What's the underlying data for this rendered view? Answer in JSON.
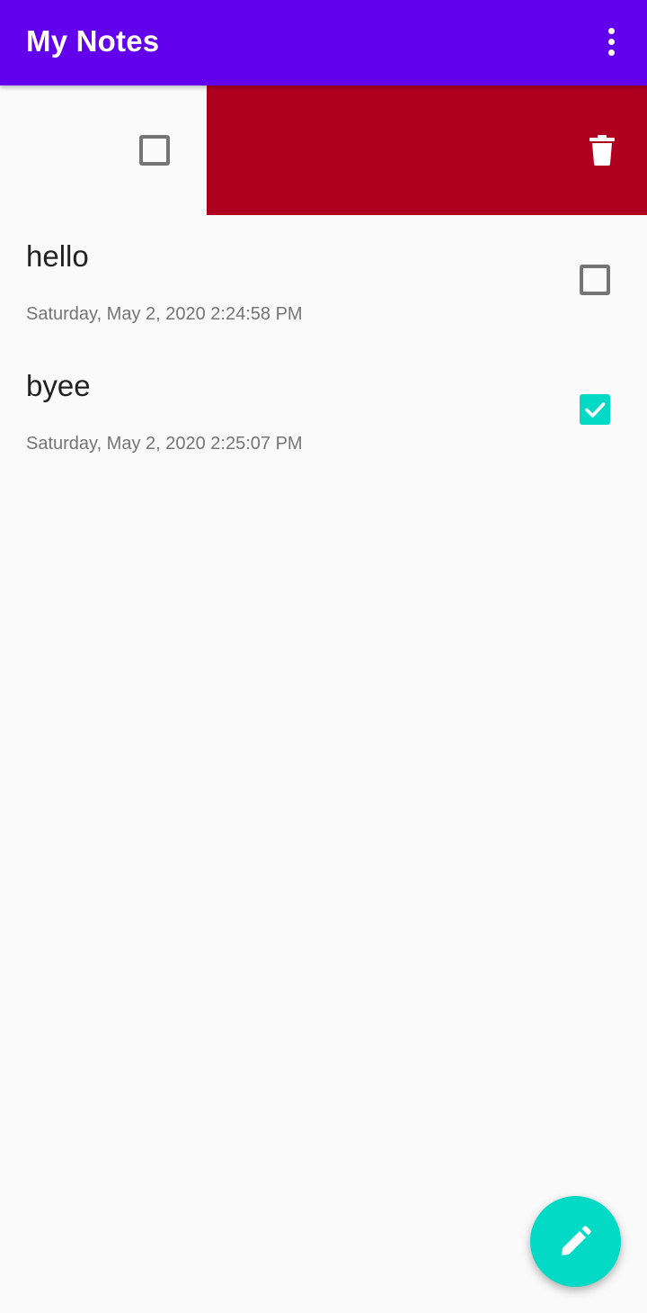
{
  "app_bar": {
    "title": "My Notes",
    "background": "#6200ee",
    "menu_icon": "more-vert-icon"
  },
  "swipe_action": {
    "background": "#b00020",
    "icon": "trash-icon",
    "checked": false
  },
  "notes": [
    {
      "title": "hello",
      "date": "Saturday, May 2, 2020 2:24:58 PM",
      "checked": false
    },
    {
      "title": "byee",
      "date": "Saturday, May 2, 2020 2:25:07 PM",
      "checked": true
    }
  ],
  "fab": {
    "icon": "pencil-icon",
    "color": "#03dac5"
  },
  "colors": {
    "accent": "#03dac5",
    "delete": "#b00020",
    "primary": "#6200ee"
  }
}
